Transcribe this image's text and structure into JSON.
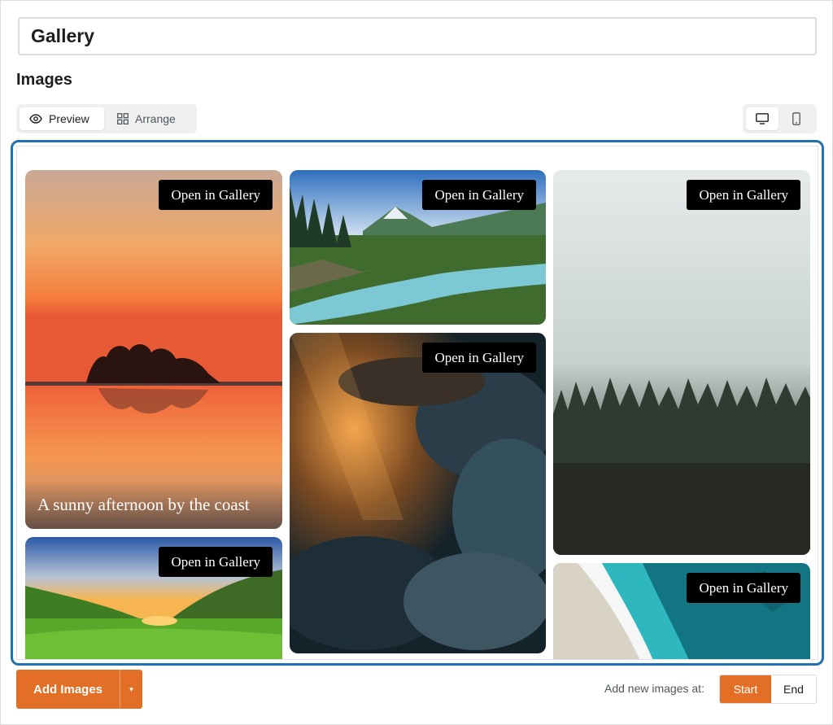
{
  "gallery_title": "Gallery",
  "section_heading": "Images",
  "mode_toggle": {
    "preview_label": "Preview",
    "arrange_label": "Arrange",
    "selected": "Preview"
  },
  "device_toggle": {
    "desktop_icon": "desktop-icon",
    "mobile_icon": "mobile-icon",
    "selected": "desktop"
  },
  "gallery": {
    "open_label": "Open in Gallery",
    "images": [
      {
        "subject": "sunset-lake-island",
        "caption": "A sunny afternoon by the coast"
      },
      {
        "subject": "grassy-valley-sunset",
        "caption": ""
      },
      {
        "subject": "mountain-river",
        "caption": ""
      },
      {
        "subject": "dramatic-clouds",
        "caption": ""
      },
      {
        "subject": "foggy-forest",
        "caption": ""
      },
      {
        "subject": "aerial-beach",
        "caption": ""
      }
    ]
  },
  "footer": {
    "add_images_label": "Add Images",
    "add_dropdown_glyph": "▾",
    "position_label": "Add new images at:",
    "start_label": "Start",
    "end_label": "End",
    "selected_position": "Start"
  },
  "colors": {
    "accent": "#e26f25",
    "focus_border": "#2271b1"
  }
}
